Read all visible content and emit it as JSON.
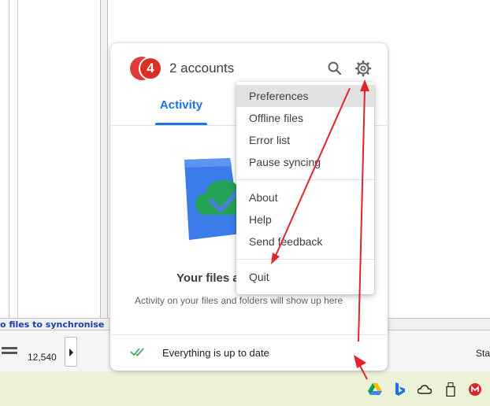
{
  "background_app": {
    "status_text": "o files to synchronise",
    "file_count": "12,540",
    "right_label": "Sta"
  },
  "drive_panel": {
    "account_badge": "4",
    "accounts_label": "2 accounts",
    "tab_activity": "Activity",
    "empty_title": "Your files a",
    "empty_subtitle": "Activity on your files and folders will show up here",
    "status_text": "Everything is up to date"
  },
  "settings_menu": {
    "items": [
      {
        "label": "Preferences",
        "highlighted": true
      },
      {
        "label": "Offline files"
      },
      {
        "label": "Error list"
      },
      {
        "label": "Pause syncing"
      },
      {
        "label": "About"
      },
      {
        "label": "Help"
      },
      {
        "label": "Send feedback"
      },
      {
        "label": "Quit"
      }
    ]
  },
  "tray": {
    "icons": [
      "google-drive-icon",
      "bing-icon",
      "onedrive-cloud-icon",
      "usb-drive-icon",
      "mega-icon"
    ]
  },
  "colors": {
    "accent_blue": "#1a73e8",
    "badge_red": "#d93025",
    "annotation_red": "#e0252b",
    "status_green": "#34a853",
    "link_blue": "#1d3fa8",
    "taskbar": "#ecf2d8"
  }
}
